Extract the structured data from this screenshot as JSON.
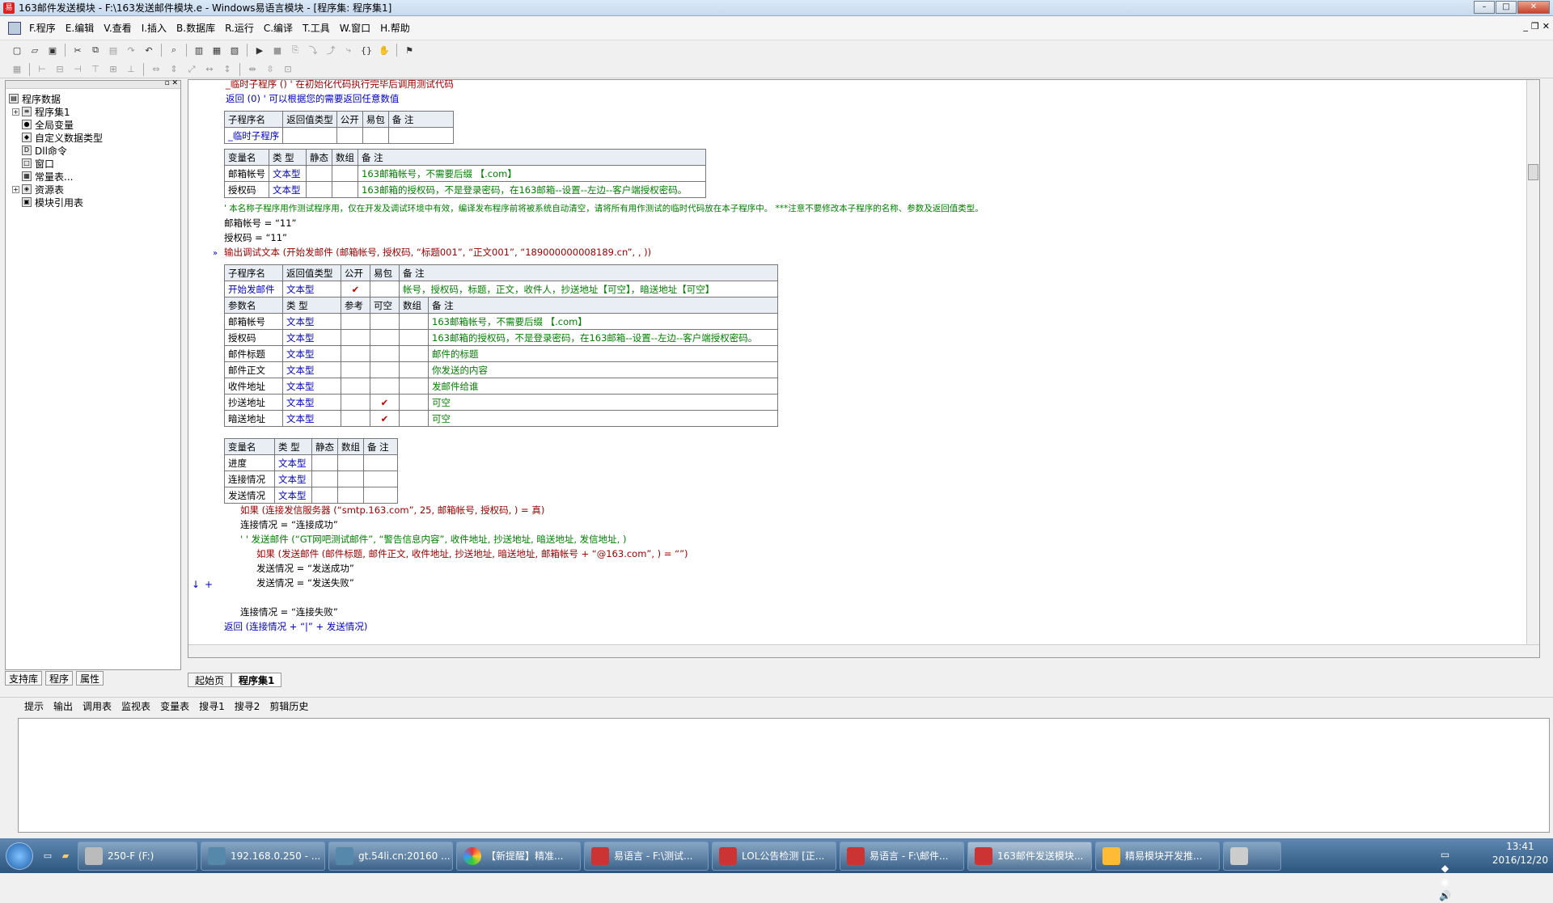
{
  "window": {
    "title": "163邮件发送模块 - F:\\163发送邮件模块.e - Windows易语言模块 - [程序集: 程序集1]"
  },
  "menu": [
    "F.程序",
    "E.编辑",
    "V.查看",
    "I.插入",
    "B.数据库",
    "R.运行",
    "C.编译",
    "T.工具",
    "W.窗口",
    "H.帮助"
  ],
  "tree": {
    "root": "程序数据",
    "items": [
      "程序集1",
      "全局变量",
      "自定义数据类型",
      "Dll命令",
      "窗口",
      "常量表...",
      "资源表",
      "模块引用表"
    ]
  },
  "left_tabs": [
    "支持库",
    "程序",
    "属性"
  ],
  "code": {
    "l1": "_临时子程序 ()  ' 在初始化代码执行完毕后调用测试代码",
    "l2": "返回 (0)  ' 可以根据您的需要返回任意数值",
    "t1_head": [
      "子程序名",
      "返回值类型",
      "公开",
      "易包",
      "备 注"
    ],
    "t1_row": [
      "_临时子程序",
      "",
      "",
      "",
      ""
    ],
    "t2_head": [
      "变量名",
      "类 型",
      "静态",
      "数组",
      "备 注"
    ],
    "t2_rows": [
      [
        "邮箱帐号",
        "文本型",
        "",
        "",
        "163邮箱帐号，不需要后缀 【.com】"
      ],
      [
        "授权码",
        "文本型",
        "",
        "",
        "163邮箱的授权码，不是登录密码，在163邮箱--设置--左边--客户端授权密码。"
      ]
    ],
    "l3": "' 本名称子程序用作测试程序用，仅在开发及调试环境中有效，编译发布程序前将被系统自动清空，请将所有用作测试的临时代码放在本子程序中。 ***注意不要修改本子程序的名称、参数及返回值类型。",
    "l4": "邮箱帐号 = “11”",
    "l5": "授权码 = “11”",
    "l6": "输出调试文本 (开始发邮件 (邮箱帐号, 授权码, “标题001”, “正文001”, “189000000008189.cn”, , ))",
    "t3_head": [
      "子程序名",
      "返回值类型",
      "公开",
      "易包",
      "备 注"
    ],
    "t3_row": [
      "开始发邮件",
      "文本型",
      "✔",
      "",
      "帐号，授权码，标题，正文，收件人，抄送地址【可空】，暗送地址【可空】"
    ],
    "t3_phead": [
      "参数名",
      "类 型",
      "参考",
      "可空",
      "数组",
      "备 注"
    ],
    "t3_params": [
      [
        "邮箱帐号",
        "文本型",
        "",
        "",
        "",
        "163邮箱帐号，不需要后缀 【.com】"
      ],
      [
        "授权码",
        "文本型",
        "",
        "",
        "",
        "163邮箱的授权码，不是登录密码，在163邮箱--设置--左边--客户端授权密码。"
      ],
      [
        "邮件标题",
        "文本型",
        "",
        "",
        "",
        "邮件的标题"
      ],
      [
        "邮件正文",
        "文本型",
        "",
        "",
        "",
        "你发送的内容"
      ],
      [
        "收件地址",
        "文本型",
        "",
        "",
        "",
        "发邮件给谁"
      ],
      [
        "抄送地址",
        "文本型",
        "",
        "✔",
        "",
        "可空"
      ],
      [
        "暗送地址",
        "文本型",
        "",
        "✔",
        "",
        "可空"
      ]
    ],
    "t4_head": [
      "变量名",
      "类 型",
      "静态",
      "数组",
      "备 注"
    ],
    "t4_rows": [
      [
        "进度",
        "文本型",
        "",
        "",
        ""
      ],
      [
        "连接情况",
        "文本型",
        "",
        "",
        ""
      ],
      [
        "发送情况",
        "文本型",
        "",
        "",
        ""
      ]
    ],
    "l7": "如果 (连接发信服务器 (“smtp.163.com”, 25, 邮箱帐号, 授权码, ) = 真)",
    "l8": "连接情况 = “连接成功”",
    "l9": "' ' 发送邮件 (“GT网吧测试邮件”, “警告信息内容”, 收件地址, 抄送地址, 暗送地址, 发信地址, )",
    "l10": "如果 (发送邮件 (邮件标题, 邮件正文, 收件地址, 抄送地址, 暗送地址, 邮箱帐号 + “@163.com”, ) = “”)",
    "l11": "发送情况 = “发送成功”",
    "l12": "发送情况 = “发送失败”",
    "l13": "连接情况 = “连接失败”",
    "l14": "返回 (连接情况 + “|” + 发送情况)"
  },
  "editor_tabs": [
    "起始页",
    "程序集1"
  ],
  "output_tabs": [
    "提示",
    "输出",
    "调用表",
    "监视表",
    "变量表",
    "搜寻1",
    "搜寻2",
    "剪辑历史"
  ],
  "taskbar": {
    "buttons": [
      "250-F (F:)",
      "192.168.0.250 - ...",
      "gt.54li.cn:20160 ...",
      "【新提醒】精准...",
      "易语言 - F:\\测试...",
      "LOL公告检测 [正...",
      "易语言 - F:\\邮件...",
      "163邮件发送模块...",
      "精易模块开发推..."
    ],
    "time": "13:41",
    "date": "2016/12/20"
  },
  "colors": {
    "keyword": "#0000cc",
    "function": "#a00000",
    "string": "#008000",
    "comment": "#008000"
  }
}
